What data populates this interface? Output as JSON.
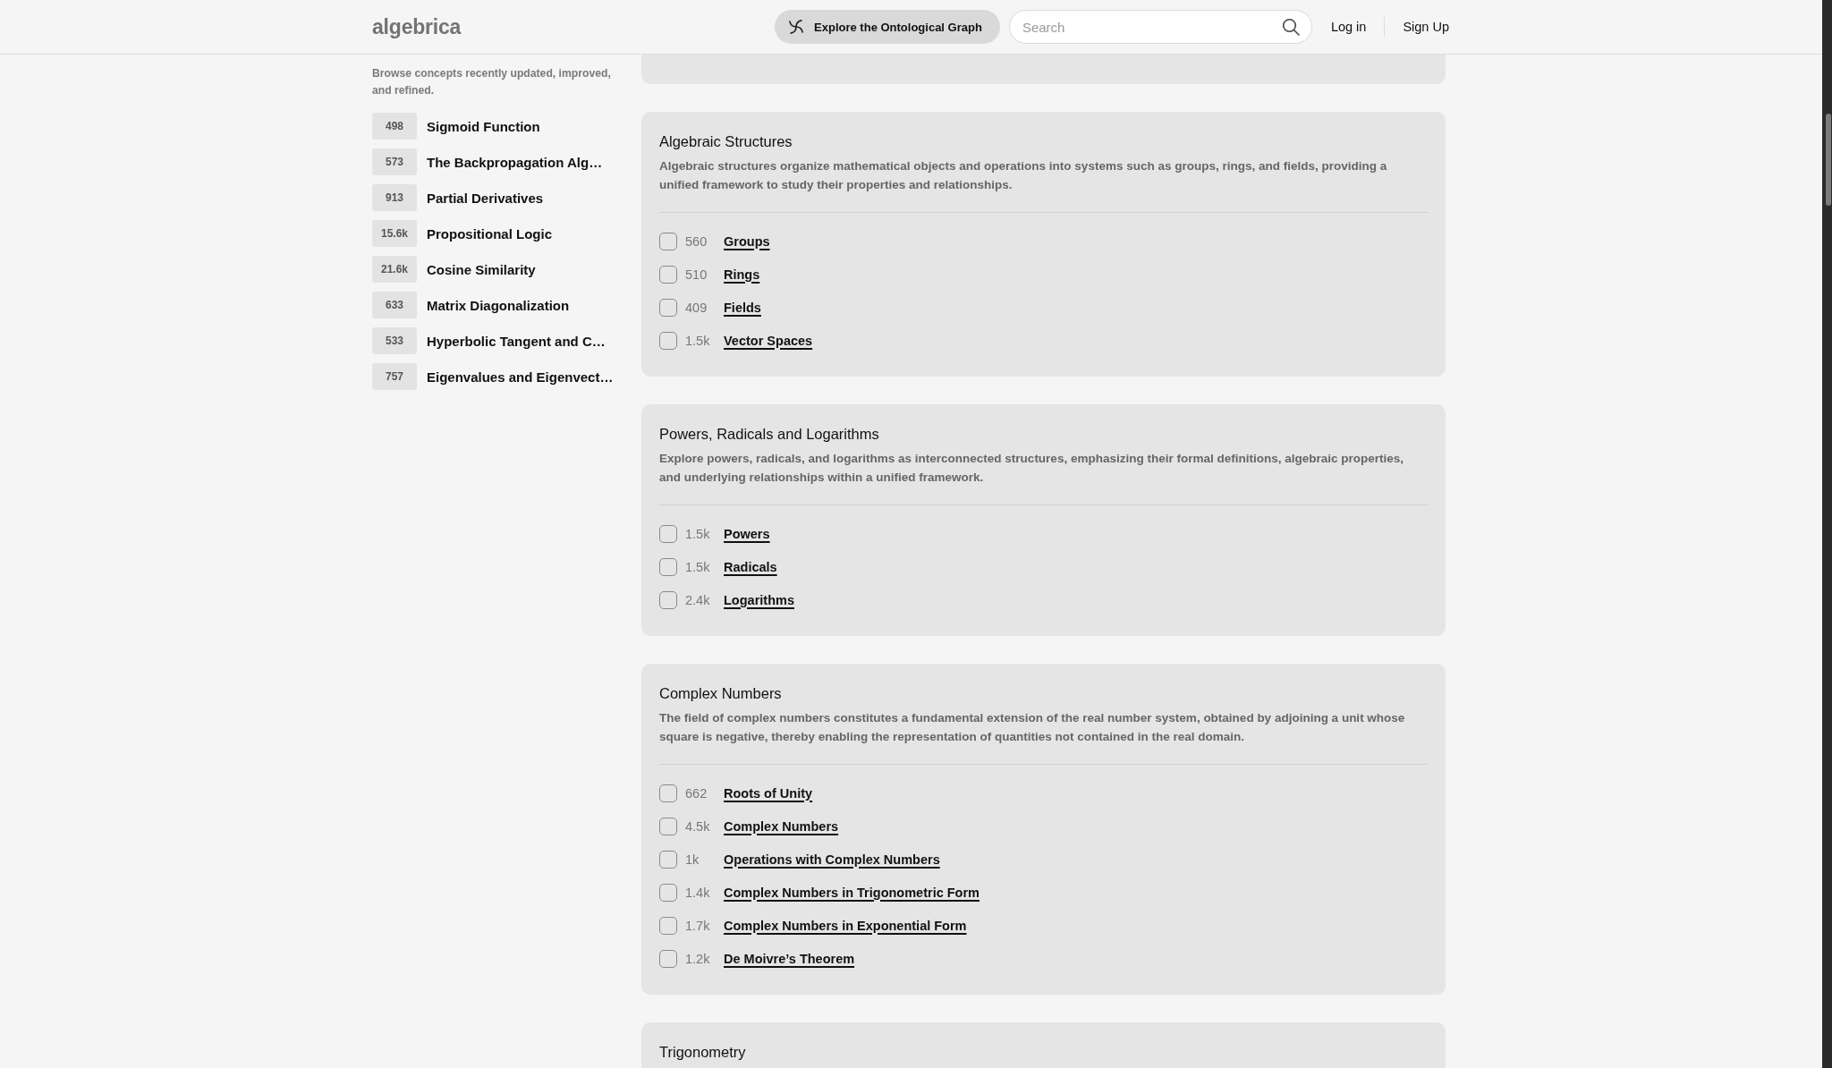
{
  "header": {
    "logo": "algebrica",
    "explore_button": "Explore the Ontological Graph",
    "search": {
      "placeholder": "Search"
    },
    "links": [
      "Log in",
      "Sign Up"
    ]
  },
  "sidebar": {
    "description": "Browse concepts recently updated, improved, and refined.",
    "items": [
      {
        "count": "498",
        "title": "Sigmoid Function"
      },
      {
        "count": "573",
        "title": "The Backpropagation Alg…"
      },
      {
        "count": "913",
        "title": "Partial Derivatives"
      },
      {
        "count": "15.6k",
        "title": "Propositional Logic"
      },
      {
        "count": "21.6k",
        "title": "Cosine Similarity"
      },
      {
        "count": "633",
        "title": "Matrix Diagonalization"
      },
      {
        "count": "533",
        "title": "Hyperbolic Tangent and C…"
      },
      {
        "count": "757",
        "title": "Eigenvalues and Eigenvect…"
      }
    ]
  },
  "topics": [
    {
      "title": "Algebraic Structures",
      "description": "Algebraic structures organize mathematical objects and operations into systems such as groups, rings, and fields, providing a unified framework to study their properties and relationships.",
      "concepts": [
        {
          "checked": false,
          "count": "560",
          "title": "Groups"
        },
        {
          "checked": false,
          "count": "510",
          "title": "Rings"
        },
        {
          "checked": false,
          "count": "409",
          "title": "Fields"
        },
        {
          "checked": false,
          "count": "1.5k",
          "title": "Vector Spaces"
        }
      ]
    },
    {
      "title": "Powers, Radicals and Logarithms",
      "description": "Explore powers, radicals, and logarithms as interconnected structures, emphasizing their formal definitions, algebraic properties, and underlying relationships within a unified framework.",
      "concepts": [
        {
          "checked": false,
          "count": "1.5k",
          "title": "Powers"
        },
        {
          "checked": false,
          "count": "1.5k",
          "title": "Radicals"
        },
        {
          "checked": false,
          "count": "2.4k",
          "title": "Logarithms"
        }
      ]
    },
    {
      "title": "Complex Numbers",
      "description": "The field of complex numbers constitutes a fundamental extension of the real number system, obtained by adjoining a unit whose square is negative, thereby enabling the representation of quantities not contained in the real domain.",
      "concepts": [
        {
          "checked": false,
          "count": "662",
          "title": "Roots of Unity"
        },
        {
          "checked": false,
          "count": "4.5k",
          "title": "Complex Numbers"
        },
        {
          "checked": false,
          "count": "1k",
          "title": "Operations with Complex Numbers"
        },
        {
          "checked": false,
          "count": "1.4k",
          "title": "Complex Numbers in Trigonometric Form"
        },
        {
          "checked": false,
          "count": "1.7k",
          "title": "Complex Numbers in Exponential Form"
        },
        {
          "checked": false,
          "count": "1.2k",
          "title": "De Moivre’s Theorem"
        }
      ]
    },
    {
      "title": "Trigonometry"
    }
  ]
}
